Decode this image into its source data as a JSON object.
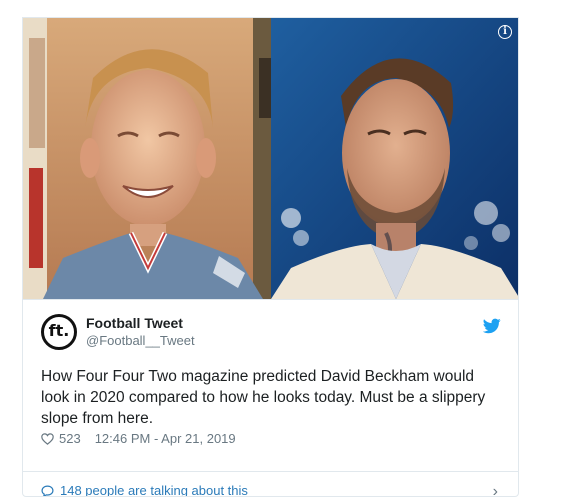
{
  "tweet": {
    "author_name": "Football Tweet",
    "author_handle": "@Football__Tweet",
    "avatar_text": "ft.",
    "text": "How Four Four Two magazine predicted David Beckham would look in 2020 compared to how he looks today. Must be a slippery slope from here.",
    "likes": "523",
    "timestamp": "12:46 PM - Apr 21, 2019",
    "conversation": "148 people are talking about this"
  },
  "media": {
    "left_alt": "magazine prediction portrait",
    "right_alt": "David Beckham photo",
    "info_glyph": "i"
  },
  "colors": {
    "twitter_blue": "#1da1f2",
    "link_blue": "#2b7bb9",
    "meta_gray": "#697882"
  }
}
